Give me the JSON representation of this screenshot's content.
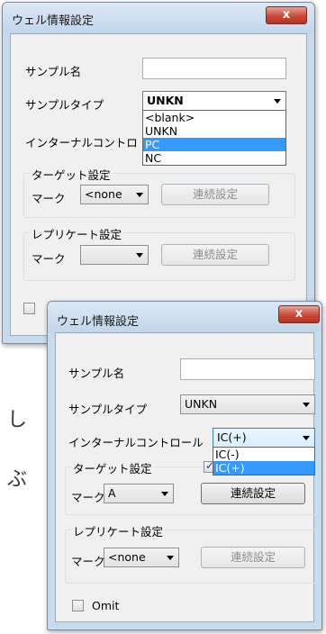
{
  "background_chars": [
    "し",
    "ぶ"
  ],
  "dialog_back": {
    "title": "ウェル情報設定",
    "close_label": "x",
    "sample_name_label": "サンプル名",
    "sample_name_value": "",
    "sample_type_label": "サンプルタイプ",
    "sample_type_value": "UNKN",
    "sample_type_options": [
      "<blank>",
      "UNKN",
      "PC",
      "NC"
    ],
    "sample_type_highlighted": "PC",
    "internal_control_label": "インターナルコントロ",
    "target_group_title": "ターゲット設定",
    "target_marker_label": "マーク",
    "target_marker_value": "<none",
    "target_continuous_button": "連続設定",
    "replicate_group_title": "レプリケート設定",
    "replicate_marker_label": "マーク",
    "replicate_marker_value": "",
    "replicate_continuous_button": "連続設定"
  },
  "dialog_front": {
    "title": "ウェル情報設定",
    "close_label": "x",
    "sample_name_label": "サンプル名",
    "sample_name_value": "",
    "sample_type_label": "サンプルタイプ",
    "sample_type_value": "UNKN",
    "internal_control_label": "インターナルコントロール",
    "internal_control_value": "IC(+)",
    "internal_control_options": [
      "IC(-)",
      "IC(+)"
    ],
    "internal_control_highlighted": "IC(+)",
    "target_group_title": "ターゲット設定",
    "target_marker_label": "マーク",
    "target_marker_value": "A",
    "target_continuous_button": "連続設定",
    "replicate_group_title": "レプリケート設定",
    "replicate_marker_label": "マーク",
    "replicate_marker_value": "<none",
    "replicate_continuous_button": "連続設定",
    "omit_label": "Omit",
    "omit_checked": false
  },
  "colors": {
    "title_bar": "#c7dbef",
    "close_button": "#c8493a",
    "highlight": "#3399ff"
  }
}
